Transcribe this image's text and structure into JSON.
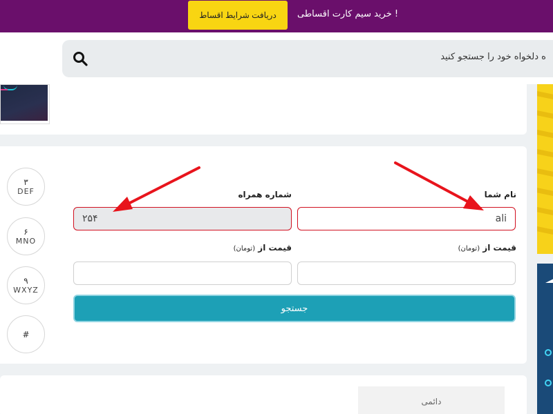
{
  "topbar": {
    "promo_text": "خرید سیم کارت اقساطی !",
    "promo_button": "دریافت شرایط اقساط"
  },
  "header": {
    "search_placeholder": "ه دلخواه خود را جستجو کنید"
  },
  "keypad": [
    {
      "digit": "۳",
      "letters": "DEF"
    },
    {
      "digit": "۶",
      "letters": "MNO"
    },
    {
      "digit": "۹",
      "letters": "WXYZ"
    },
    {
      "digit": "#",
      "letters": ""
    }
  ],
  "form": {
    "name_label": "نام شما",
    "name_value": "ali",
    "phone_label": "شماره همراه",
    "phone_value": "۲۵۴",
    "price_label_right": "قیمت از",
    "price_unit_right": "(تومان)",
    "price_label_left": "قیمت از",
    "price_unit_left": "(تومان)",
    "price_value_right": "",
    "price_value_left": "",
    "submit_label": "جستجو"
  },
  "tabs": {
    "daemi": "دائمی"
  },
  "colors": {
    "topbar_bg": "#6a0f6b",
    "promo_button_bg": "#f8d512",
    "submit_bg": "#1da0b6",
    "error_border": "#d10f1f",
    "annotation_arrow": "#e8141c"
  }
}
